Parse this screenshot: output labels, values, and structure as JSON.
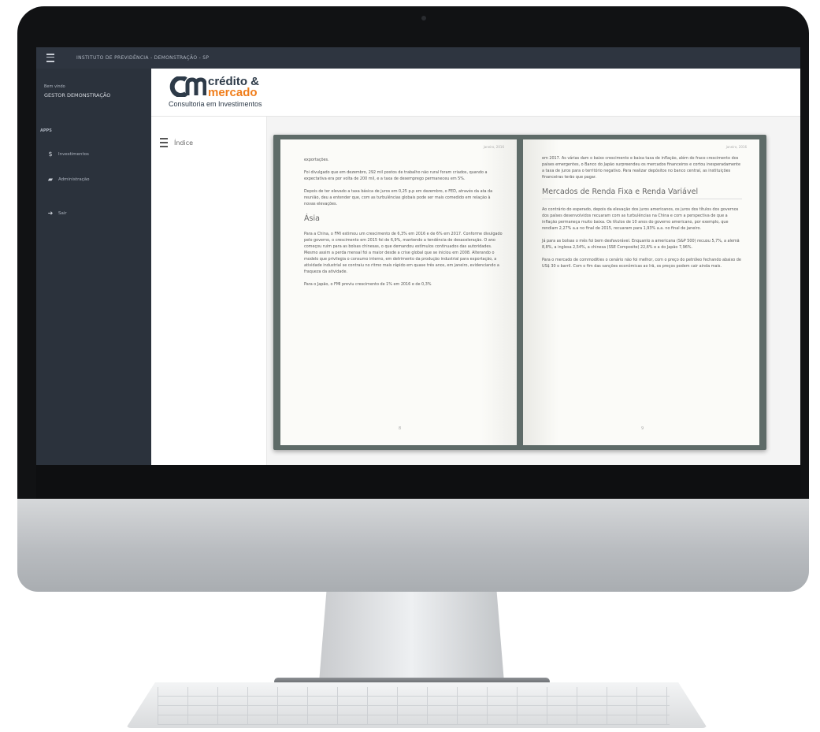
{
  "topbar": {
    "title": "INSTITUTO DE PREVIDÊNCIA - DEMONSTRAÇÃO - SP"
  },
  "sidebar": {
    "welcome": "Bem vindo",
    "user": "GESTOR DEMONSTRAÇÃO",
    "apps_label": "APPS",
    "items": [
      {
        "label": "Investimentos",
        "icon": "dollar-icon"
      },
      {
        "label": "Administração",
        "icon": "folder-icon"
      },
      {
        "label": "Sair",
        "icon": "sign-out-icon"
      }
    ]
  },
  "logo": {
    "line1": "crédito &",
    "line2": "mercado",
    "tagline": "Consultoria em Investimentos"
  },
  "index": {
    "label": "Índice"
  },
  "book": {
    "left": {
      "date": "janeiro, 2016",
      "p1": "exportações.",
      "p2": "Foi divulgado que em dezembro, 292 mil postos de trabalho não rural foram criados, quando a expectativa era por volta de 200 mil, e a taxa de desemprego permaneceu em 5%.",
      "p3": "Depois de ter elevado a taxa básica de juros em 0,25 p.p em dezembro, o FED, através da ata da reunião, deu a entender que, com as turbulências globais pode ser mais comedido em relação à novas elevações.",
      "heading": "Ásia",
      "p4": "Para a China, o FMI estimou um crescimento de 6,3% em 2016 e de 6% em 2017. Conforme divulgado pelo governo, o crescimento em 2015 foi de 6,9%, mantendo a tendência de desaceleração. O ano começou ruim para as bolsas chinesas, o que demandou estímulos continuados das autoridades. Mesmo assim a perda mensal foi a maior desde a crise global que se iniciou em 2008. Alterando o modelo que privilegia o consumo interno, em detrimento da produção industrial para exportação, a atividade industrial se contraiu no ritmo mais rápido em quase três anos, em janeiro, evidenciando a fraqueza da atividade.",
      "p5": "Para o Japão, o FMI previu crescimento de 1% em 2016 e de 0,3%",
      "page": "8"
    },
    "right": {
      "date": "janeiro, 2016",
      "p1": "em 2017. As várias dam o baixo crescimento e baixa taxa de inflação, além do fraco crescimento dos países emergentes, o Banco do Japão surpreendeu os mercados financeiros e cortou inesperadamente a taxa de juros para o território negativo. Para realizar depósitos no banco central, as instituições financeiras terão que pagar.",
      "heading": "Mercados de Renda Fixa e Renda Variável",
      "p2": "Ao contrário do esperado, depois da elevação dos juros americanos, os juros dos títulos dos governos dos países desenvolvidos recuaram com as turbulências na China e com a perspectiva de que a inflação permaneça muito baixa. Os títulos de 10 anos do governo americano, por exemplo, que rendiam 2,27% a.a no final de 2015, recuaram para 1,93% a.a. no final de janeiro.",
      "p3": "Já para as bolsas o mês foi bem desfavorável. Enquanto a americana (S&P 500) recuou 5,7%, a alemã 8,8%, a inglesa 2,54%, a chinesa (SSE Composite) 22,6% e a do Japão 7,96%.",
      "p4": "Para o mercado de commodities o cenário não foi melhor, com o preço do petróleo fechando abaixo de US$ 30 o barril. Com o fim das sanções econômicas ao Irã, os preços podem cair ainda mais.",
      "page": "9"
    }
  }
}
